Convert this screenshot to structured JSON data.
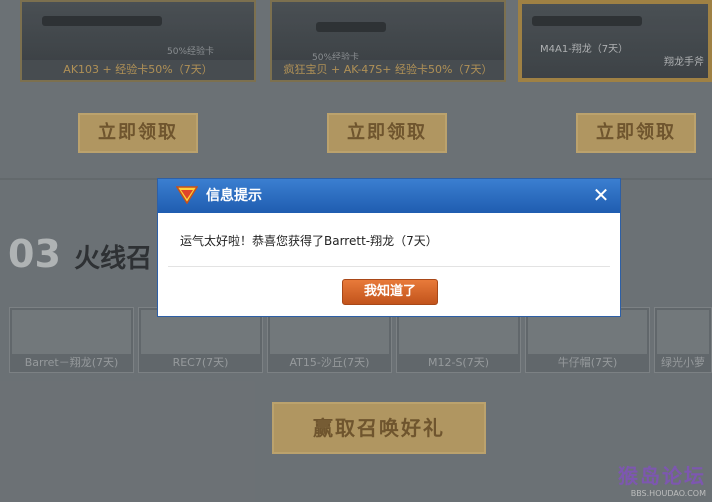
{
  "top_cards": [
    {
      "caption": "AK103 + 经验卡50%（7天）",
      "badge": "50%经验卡"
    },
    {
      "caption": "疯狂宝贝 + AK-47S+ 经验卡50%（7天）",
      "badge": "50%经验卡"
    },
    {
      "caption": "M4A1-翔龙（7天）",
      "extra": "翔龙手斧"
    }
  ],
  "claim_label": "立即领取",
  "section": {
    "number": "03",
    "title": "火线召"
  },
  "items": [
    {
      "label": "Barret－翔龙(7天)"
    },
    {
      "label": "REC7(7天)"
    },
    {
      "label": "AT15-沙丘(7天)"
    },
    {
      "label": "M12-S(7天)"
    },
    {
      "label": "牛仔帽(7天)"
    },
    {
      "label": "绿光小萝"
    }
  ],
  "reward_button": "赢取召唤好礼",
  "watermark": {
    "brand": "猴岛论坛",
    "url": "BBS.HOUDAO.COM"
  },
  "dialog": {
    "title": "信息提示",
    "message": "运气太好啦！恭喜您获得了Barrett-翔龙（7天）",
    "ok_label": "我知道了",
    "close_symbol": "✕"
  }
}
